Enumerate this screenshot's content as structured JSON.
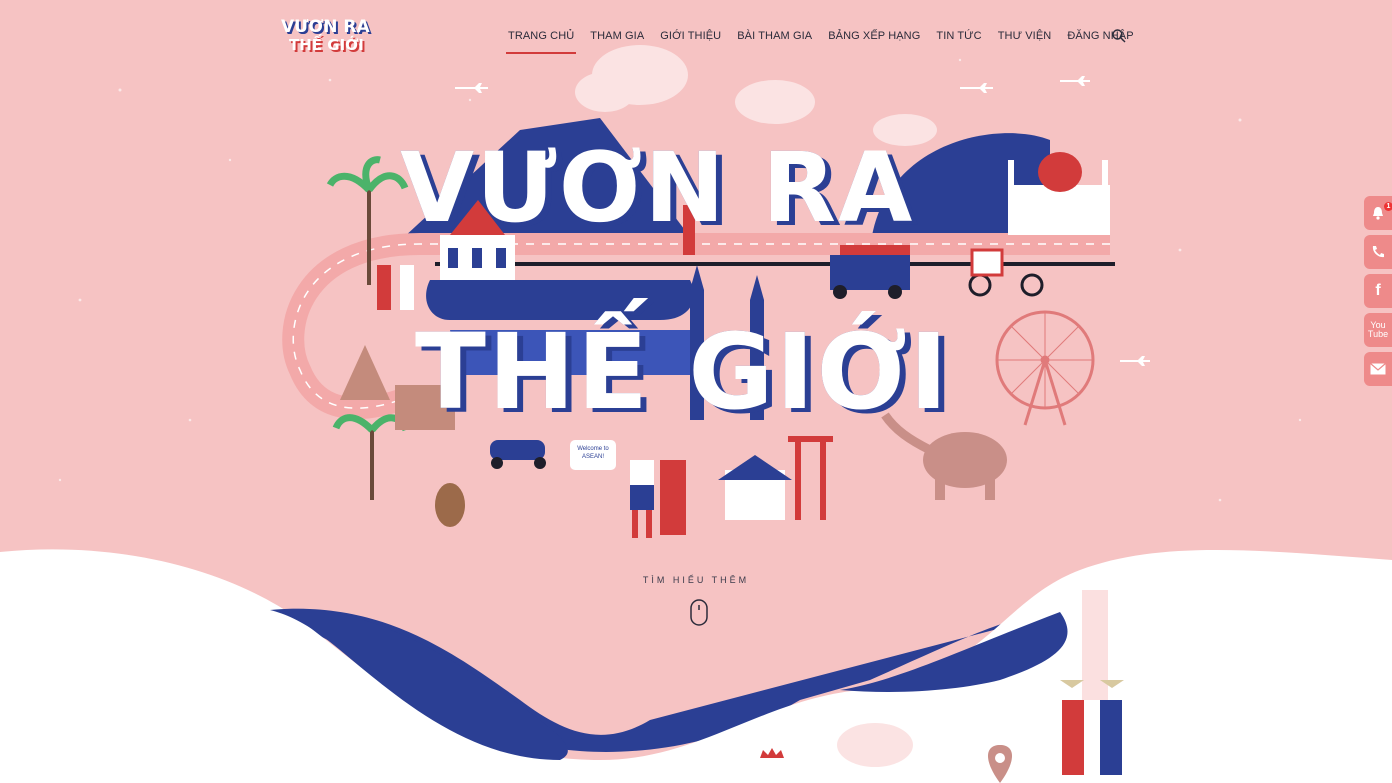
{
  "logo": {
    "line1": "VƯƠN RA",
    "line2": "THẾ GIỚI"
  },
  "nav": {
    "items": [
      {
        "label": "TRANG CHỦ",
        "active": true
      },
      {
        "label": "THAM GIA"
      },
      {
        "label": "GIỚI THIỆU"
      },
      {
        "label": "BÀI THAM GIA"
      },
      {
        "label": "BẢNG XẾP HẠNG"
      },
      {
        "label": "TIN TỨC"
      },
      {
        "label": "THƯ VIỆN"
      },
      {
        "label": "ĐĂNG NHẬP"
      }
    ],
    "search_icon": "search-icon"
  },
  "hero": {
    "title_line1": "VƯƠN RA",
    "title_line2": "THẾ GIỚI",
    "sign_text": "Welcome to ASEAN!",
    "learn_more": "TÌM HIỂU THÊM"
  },
  "side_buttons": [
    {
      "icon": "bell-icon",
      "badge": "1"
    },
    {
      "icon": "phone-icon"
    },
    {
      "icon": "facebook-icon",
      "label": "f"
    },
    {
      "icon": "youtube-icon",
      "label": "You Tube"
    },
    {
      "icon": "mail-icon"
    }
  ],
  "colors": {
    "background": "#f6c3c3",
    "navy": "#2b3f94",
    "red": "#d23b3b",
    "white": "#ffffff",
    "side_button": "#ee8a8a"
  }
}
